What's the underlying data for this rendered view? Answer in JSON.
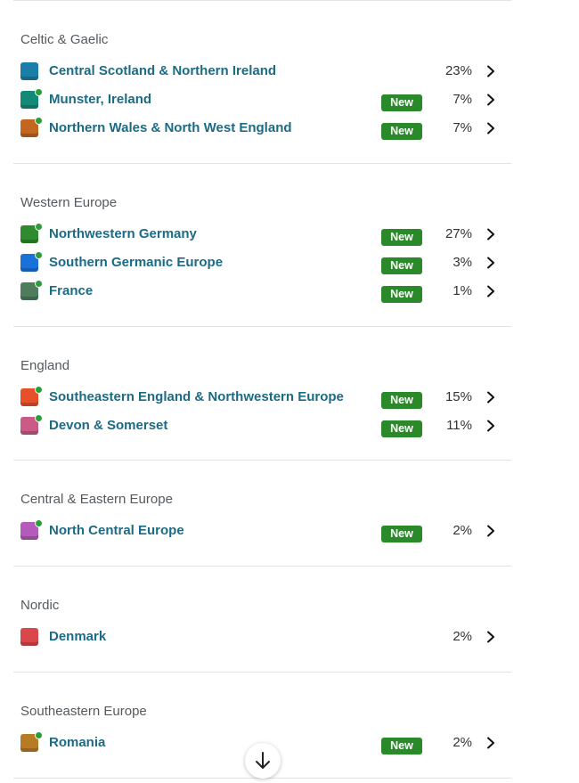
{
  "badge_label": "New",
  "sections": [
    {
      "title": "Celtic & Gaelic",
      "rows": [
        {
          "region": "Central Scotland & Northern Ireland",
          "pct": "23%",
          "new": false,
          "color": "#1a7fa8"
        },
        {
          "region": "Munster, Ireland",
          "pct": "7%",
          "new": true,
          "color": "#138a78"
        },
        {
          "region": "Northern Wales & North West England",
          "pct": "7%",
          "new": true,
          "color": "#c3661f"
        }
      ]
    },
    {
      "title": "Western Europe",
      "rows": [
        {
          "region": "Northwestern Germany",
          "pct": "27%",
          "new": true,
          "color": "#2e8b2e"
        },
        {
          "region": "Southern Germanic Europe",
          "pct": "3%",
          "new": true,
          "color": "#1a72d8"
        },
        {
          "region": "France",
          "pct": "1%",
          "new": true,
          "color": "#4e7d5e"
        }
      ]
    },
    {
      "title": "England",
      "rows": [
        {
          "region": "Southeastern England & Northwestern Europe",
          "pct": "15%",
          "new": true,
          "color": "#e8502a"
        },
        {
          "region": "Devon & Somerset",
          "pct": "11%",
          "new": true,
          "color": "#c95b86"
        }
      ]
    },
    {
      "title": "Central & Eastern Europe",
      "rows": [
        {
          "region": "North Central Europe",
          "pct": "2%",
          "new": true,
          "color": "#b45aba"
        }
      ]
    },
    {
      "title": "Nordic",
      "rows": [
        {
          "region": "Denmark",
          "pct": "2%",
          "new": false,
          "color": "#d9474b"
        }
      ]
    },
    {
      "title": "Southeastern Europe",
      "rows": [
        {
          "region": "Romania",
          "pct": "2%",
          "new": true,
          "color": "#b77b26"
        }
      ]
    }
  ],
  "scroll_down_icon": "arrow-down-icon",
  "chevron_icon": "chevron-right-icon",
  "colors": {
    "region_link": "#1b6b86",
    "badge_bg": "#2a8a2a",
    "new_dot": "#2a9d3a",
    "divider": "#e3e3e3"
  }
}
